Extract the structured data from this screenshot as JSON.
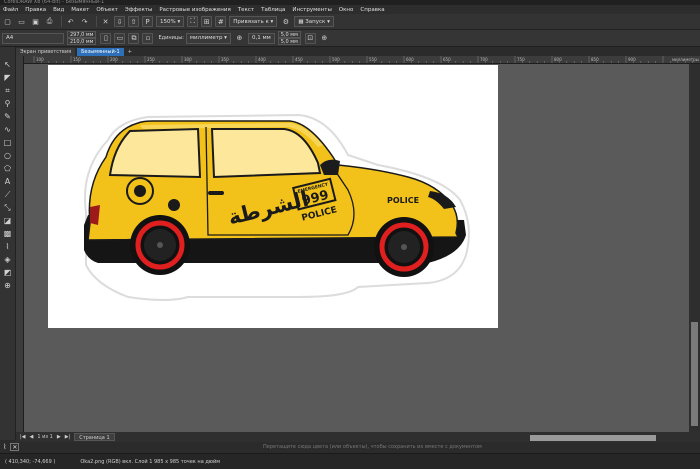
{
  "window": {
    "title": "CorelDRAW X8 (64-bit) - Безымянный-1"
  },
  "menu": [
    "Файл",
    "Правка",
    "Вид",
    "Макет",
    "Объект",
    "Эффекты",
    "Растровые изображения",
    "Текст",
    "Таблица",
    "Инструменты",
    "Окно",
    "Справка"
  ],
  "toolbar": {
    "zoom": "150%",
    "snap": "Привязать к",
    "launch": "Запуск"
  },
  "propbar": {
    "page_size": "A4",
    "width": "297,0 мм",
    "height": "210,0 мм",
    "units_label": "Единицы:",
    "units": "миллиметр",
    "nudge": "0,1 мм",
    "dup_x": "5,0 мм",
    "dup_y": "5,0 мм"
  },
  "tabs": [
    {
      "label": "Экран приветствия",
      "active": false
    },
    {
      "label": "Безымянный-1",
      "active": true
    }
  ],
  "ruler": [
    "100",
    "150",
    "200",
    "250",
    "300",
    "350",
    "400",
    "450",
    "500",
    "550",
    "600",
    "650",
    "700",
    "750",
    "800",
    "850",
    "900",
    "миллиметры"
  ],
  "pagebar": {
    "nav": "1 из 1",
    "page_tab": "Страница 1"
  },
  "hint": "Перетащите сюда цвета (или объекты), чтобы сохранить их вместе с документом",
  "status": {
    "coords": "( 410,340; -74,669 )",
    "info": "Oka2.png (RGB) вкл. Слой 1 985 x 985 точек на дюйм"
  },
  "artwork": {
    "arabic": "الشرطة",
    "emergency": "EMERGENCY",
    "number": "999",
    "police_door": "POLICE",
    "police_hood": "POLICE"
  }
}
